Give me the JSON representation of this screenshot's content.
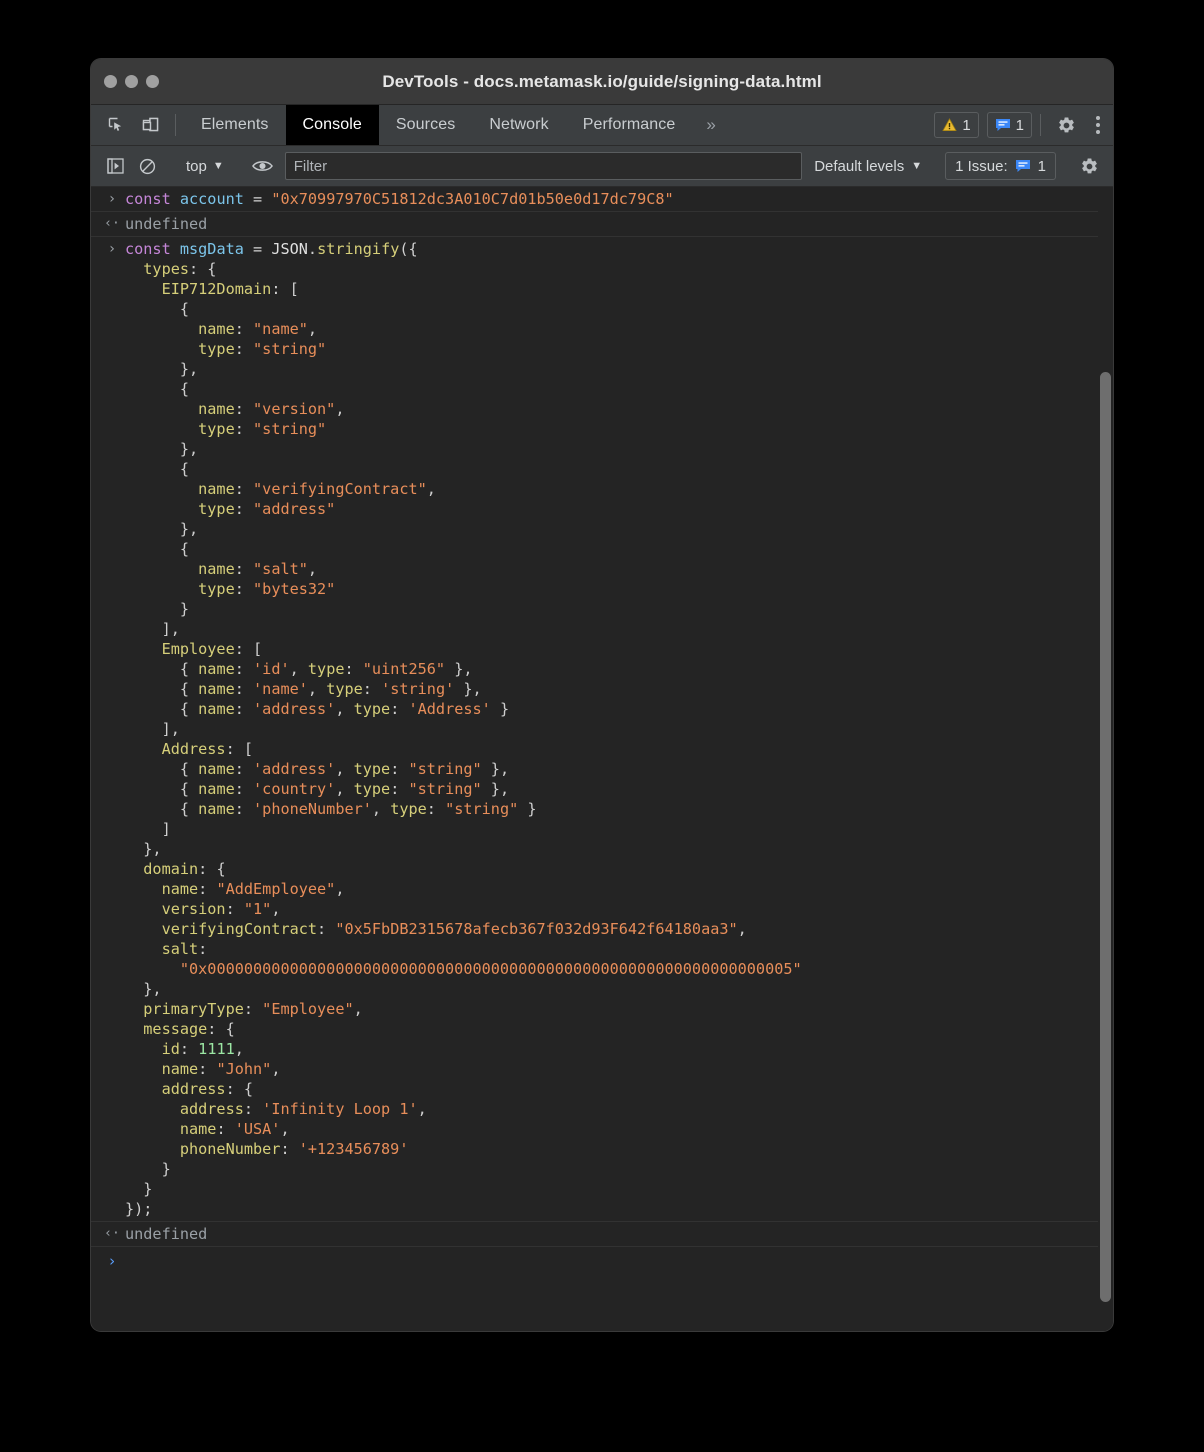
{
  "window": {
    "title": "DevTools - docs.metamask.io/guide/signing-data.html",
    "traffic_lights": [
      "close",
      "minimize",
      "zoom"
    ]
  },
  "tabbar": {
    "inspect_icon": "inspect-element-icon",
    "device_icon": "device-toolbar-icon",
    "tabs": [
      {
        "label": "Elements",
        "selected": false
      },
      {
        "label": "Console",
        "selected": true
      },
      {
        "label": "Sources",
        "selected": false
      },
      {
        "label": "Network",
        "selected": false
      },
      {
        "label": "Performance",
        "selected": false
      }
    ],
    "overflow_label": "»",
    "warning_badge": {
      "icon": "warning-triangle-icon",
      "count": "1",
      "color": "#e8b931"
    },
    "message_badge": {
      "icon": "message-bubble-icon",
      "count": "1",
      "color": "#3b87f7"
    },
    "settings_icon": "gear-icon",
    "more_icon": "kebab-menu-icon"
  },
  "console_toolbar": {
    "sidebar_toggle_icon": "console-sidebar-toggle-icon",
    "clear_icon": "clear-console-icon",
    "context": "top",
    "context_caret": "▼",
    "live_expression_icon": "eye-icon",
    "filter_placeholder": "Filter",
    "filter_value": "",
    "levels_label": "Default levels",
    "levels_caret": "▼",
    "issues_label": "1 Issue:",
    "issues_icon": "message-bubble-icon",
    "issues_count": "1",
    "settings_icon": "gear-icon"
  },
  "console": {
    "input_glyph": "›",
    "result_glyph": "‹·",
    "prompt_glyph": "›",
    "messages": [
      {
        "kind": "input",
        "lines": [
          [
            {
              "t": "const",
              "c": "kw"
            },
            {
              "t": " ",
              "c": "plain"
            },
            {
              "t": "account",
              "c": "var"
            },
            {
              "t": " = ",
              "c": "op"
            },
            {
              "t": "\"0x70997970C51812dc3A010C7d01b50e0d17dc79C8\"",
              "c": "str"
            }
          ]
        ]
      },
      {
        "kind": "result",
        "text": "undefined"
      },
      {
        "kind": "input",
        "lines": [
          [
            {
              "t": "const",
              "c": "kw"
            },
            {
              "t": " ",
              "c": "plain"
            },
            {
              "t": "msgData",
              "c": "var"
            },
            {
              "t": " = ",
              "c": "op"
            },
            {
              "t": "JSON",
              "c": "plain"
            },
            {
              "t": ".",
              "c": "punc"
            },
            {
              "t": "stringify",
              "c": "fn"
            },
            {
              "t": "({",
              "c": "punc"
            }
          ],
          [
            {
              "t": "  types",
              "c": "key"
            },
            {
              "t": ": {",
              "c": "punc"
            }
          ],
          [
            {
              "t": "    EIP712Domain",
              "c": "key"
            },
            {
              "t": ": [",
              "c": "punc"
            }
          ],
          [
            {
              "t": "      {",
              "c": "punc"
            }
          ],
          [
            {
              "t": "        name",
              "c": "key"
            },
            {
              "t": ": ",
              "c": "punc"
            },
            {
              "t": "\"name\"",
              "c": "str"
            },
            {
              "t": ",",
              "c": "punc"
            }
          ],
          [
            {
              "t": "        type",
              "c": "key"
            },
            {
              "t": ": ",
              "c": "punc"
            },
            {
              "t": "\"string\"",
              "c": "str"
            }
          ],
          [
            {
              "t": "      },",
              "c": "punc"
            }
          ],
          [
            {
              "t": "      {",
              "c": "punc"
            }
          ],
          [
            {
              "t": "        name",
              "c": "key"
            },
            {
              "t": ": ",
              "c": "punc"
            },
            {
              "t": "\"version\"",
              "c": "str"
            },
            {
              "t": ",",
              "c": "punc"
            }
          ],
          [
            {
              "t": "        type",
              "c": "key"
            },
            {
              "t": ": ",
              "c": "punc"
            },
            {
              "t": "\"string\"",
              "c": "str"
            }
          ],
          [
            {
              "t": "      },",
              "c": "punc"
            }
          ],
          [
            {
              "t": "      {",
              "c": "punc"
            }
          ],
          [
            {
              "t": "        name",
              "c": "key"
            },
            {
              "t": ": ",
              "c": "punc"
            },
            {
              "t": "\"verifyingContract\"",
              "c": "str"
            },
            {
              "t": ",",
              "c": "punc"
            }
          ],
          [
            {
              "t": "        type",
              "c": "key"
            },
            {
              "t": ": ",
              "c": "punc"
            },
            {
              "t": "\"address\"",
              "c": "str"
            }
          ],
          [
            {
              "t": "      },",
              "c": "punc"
            }
          ],
          [
            {
              "t": "      {",
              "c": "punc"
            }
          ],
          [
            {
              "t": "        name",
              "c": "key"
            },
            {
              "t": ": ",
              "c": "punc"
            },
            {
              "t": "\"salt\"",
              "c": "str"
            },
            {
              "t": ",",
              "c": "punc"
            }
          ],
          [
            {
              "t": "        type",
              "c": "key"
            },
            {
              "t": ": ",
              "c": "punc"
            },
            {
              "t": "\"bytes32\"",
              "c": "str"
            }
          ],
          [
            {
              "t": "      }",
              "c": "punc"
            }
          ],
          [
            {
              "t": "    ],",
              "c": "punc"
            }
          ],
          [
            {
              "t": "    Employee",
              "c": "key"
            },
            {
              "t": ": [",
              "c": "punc"
            }
          ],
          [
            {
              "t": "      { ",
              "c": "punc"
            },
            {
              "t": "name",
              "c": "key"
            },
            {
              "t": ": ",
              "c": "punc"
            },
            {
              "t": "'id'",
              "c": "str"
            },
            {
              "t": ", ",
              "c": "punc"
            },
            {
              "t": "type",
              "c": "key"
            },
            {
              "t": ": ",
              "c": "punc"
            },
            {
              "t": "\"uint256\"",
              "c": "str"
            },
            {
              "t": " },",
              "c": "punc"
            }
          ],
          [
            {
              "t": "      { ",
              "c": "punc"
            },
            {
              "t": "name",
              "c": "key"
            },
            {
              "t": ": ",
              "c": "punc"
            },
            {
              "t": "'name'",
              "c": "str"
            },
            {
              "t": ", ",
              "c": "punc"
            },
            {
              "t": "type",
              "c": "key"
            },
            {
              "t": ": ",
              "c": "punc"
            },
            {
              "t": "'string'",
              "c": "str"
            },
            {
              "t": " },",
              "c": "punc"
            }
          ],
          [
            {
              "t": "      { ",
              "c": "punc"
            },
            {
              "t": "name",
              "c": "key"
            },
            {
              "t": ": ",
              "c": "punc"
            },
            {
              "t": "'address'",
              "c": "str"
            },
            {
              "t": ", ",
              "c": "punc"
            },
            {
              "t": "type",
              "c": "key"
            },
            {
              "t": ": ",
              "c": "punc"
            },
            {
              "t": "'Address'",
              "c": "str"
            },
            {
              "t": " }",
              "c": "punc"
            }
          ],
          [
            {
              "t": "    ],",
              "c": "punc"
            }
          ],
          [
            {
              "t": "    Address",
              "c": "key"
            },
            {
              "t": ": [",
              "c": "punc"
            }
          ],
          [
            {
              "t": "      { ",
              "c": "punc"
            },
            {
              "t": "name",
              "c": "key"
            },
            {
              "t": ": ",
              "c": "punc"
            },
            {
              "t": "'address'",
              "c": "str"
            },
            {
              "t": ", ",
              "c": "punc"
            },
            {
              "t": "type",
              "c": "key"
            },
            {
              "t": ": ",
              "c": "punc"
            },
            {
              "t": "\"string\"",
              "c": "str"
            },
            {
              "t": " },",
              "c": "punc"
            }
          ],
          [
            {
              "t": "      { ",
              "c": "punc"
            },
            {
              "t": "name",
              "c": "key"
            },
            {
              "t": ": ",
              "c": "punc"
            },
            {
              "t": "'country'",
              "c": "str"
            },
            {
              "t": ", ",
              "c": "punc"
            },
            {
              "t": "type",
              "c": "key"
            },
            {
              "t": ": ",
              "c": "punc"
            },
            {
              "t": "\"string\"",
              "c": "str"
            },
            {
              "t": " },",
              "c": "punc"
            }
          ],
          [
            {
              "t": "      { ",
              "c": "punc"
            },
            {
              "t": "name",
              "c": "key"
            },
            {
              "t": ": ",
              "c": "punc"
            },
            {
              "t": "'phoneNumber'",
              "c": "str"
            },
            {
              "t": ", ",
              "c": "punc"
            },
            {
              "t": "type",
              "c": "key"
            },
            {
              "t": ": ",
              "c": "punc"
            },
            {
              "t": "\"string\"",
              "c": "str"
            },
            {
              "t": " }",
              "c": "punc"
            }
          ],
          [
            {
              "t": "    ]",
              "c": "punc"
            }
          ],
          [
            {
              "t": "  },",
              "c": "punc"
            }
          ],
          [
            {
              "t": "  domain",
              "c": "key"
            },
            {
              "t": ": {",
              "c": "punc"
            }
          ],
          [
            {
              "t": "    name",
              "c": "key"
            },
            {
              "t": ": ",
              "c": "punc"
            },
            {
              "t": "\"AddEmployee\"",
              "c": "str"
            },
            {
              "t": ",",
              "c": "punc"
            }
          ],
          [
            {
              "t": "    version",
              "c": "key"
            },
            {
              "t": ": ",
              "c": "punc"
            },
            {
              "t": "\"1\"",
              "c": "str"
            },
            {
              "t": ",",
              "c": "punc"
            }
          ],
          [
            {
              "t": "    verifyingContract",
              "c": "key"
            },
            {
              "t": ": ",
              "c": "punc"
            },
            {
              "t": "\"0x5FbDB2315678afecb367f032d93F642f64180aa3\"",
              "c": "str"
            },
            {
              "t": ",",
              "c": "punc"
            }
          ],
          [
            {
              "t": "    salt",
              "c": "key"
            },
            {
              "t": ":",
              "c": "punc"
            }
          ],
          [
            {
              "t": "      ",
              "c": "punc"
            },
            {
              "t": "\"0x0000000000000000000000000000000000000000000000000000000000000005\"",
              "c": "str"
            }
          ],
          [
            {
              "t": "  },",
              "c": "punc"
            }
          ],
          [
            {
              "t": "  primaryType",
              "c": "key"
            },
            {
              "t": ": ",
              "c": "punc"
            },
            {
              "t": "\"Employee\"",
              "c": "str"
            },
            {
              "t": ",",
              "c": "punc"
            }
          ],
          [
            {
              "t": "  message",
              "c": "key"
            },
            {
              "t": ": {",
              "c": "punc"
            }
          ],
          [
            {
              "t": "    id",
              "c": "key"
            },
            {
              "t": ": ",
              "c": "punc"
            },
            {
              "t": "1111",
              "c": "num"
            },
            {
              "t": ",",
              "c": "punc"
            }
          ],
          [
            {
              "t": "    name",
              "c": "key"
            },
            {
              "t": ": ",
              "c": "punc"
            },
            {
              "t": "\"John\"",
              "c": "str"
            },
            {
              "t": ",",
              "c": "punc"
            }
          ],
          [
            {
              "t": "    address",
              "c": "key"
            },
            {
              "t": ": {",
              "c": "punc"
            }
          ],
          [
            {
              "t": "      address",
              "c": "key"
            },
            {
              "t": ": ",
              "c": "punc"
            },
            {
              "t": "'Infinity Loop 1'",
              "c": "str"
            },
            {
              "t": ",",
              "c": "punc"
            }
          ],
          [
            {
              "t": "      name",
              "c": "key"
            },
            {
              "t": ": ",
              "c": "punc"
            },
            {
              "t": "'USA'",
              "c": "str"
            },
            {
              "t": ",",
              "c": "punc"
            }
          ],
          [
            {
              "t": "      phoneNumber",
              "c": "key"
            },
            {
              "t": ": ",
              "c": "punc"
            },
            {
              "t": "'+123456789'",
              "c": "str"
            }
          ],
          [
            {
              "t": "    }",
              "c": "punc"
            }
          ],
          [
            {
              "t": "  }",
              "c": "punc"
            }
          ],
          [
            {
              "t": "});",
              "c": "punc"
            }
          ]
        ]
      },
      {
        "kind": "result",
        "text": "undefined"
      }
    ]
  },
  "colors": {
    "background": "#242424",
    "toolbar": "#3c3f41",
    "titlebar": "#3a3a3a",
    "accent_blue": "#3b87f7",
    "warning_yellow": "#e8b931",
    "string_orange": "#e88e5a",
    "key_yellow": "#d6cf7a",
    "keyword_purple": "#c586d8",
    "identifier_blue": "#7cc5ea",
    "number_green": "#9ce7a4"
  }
}
